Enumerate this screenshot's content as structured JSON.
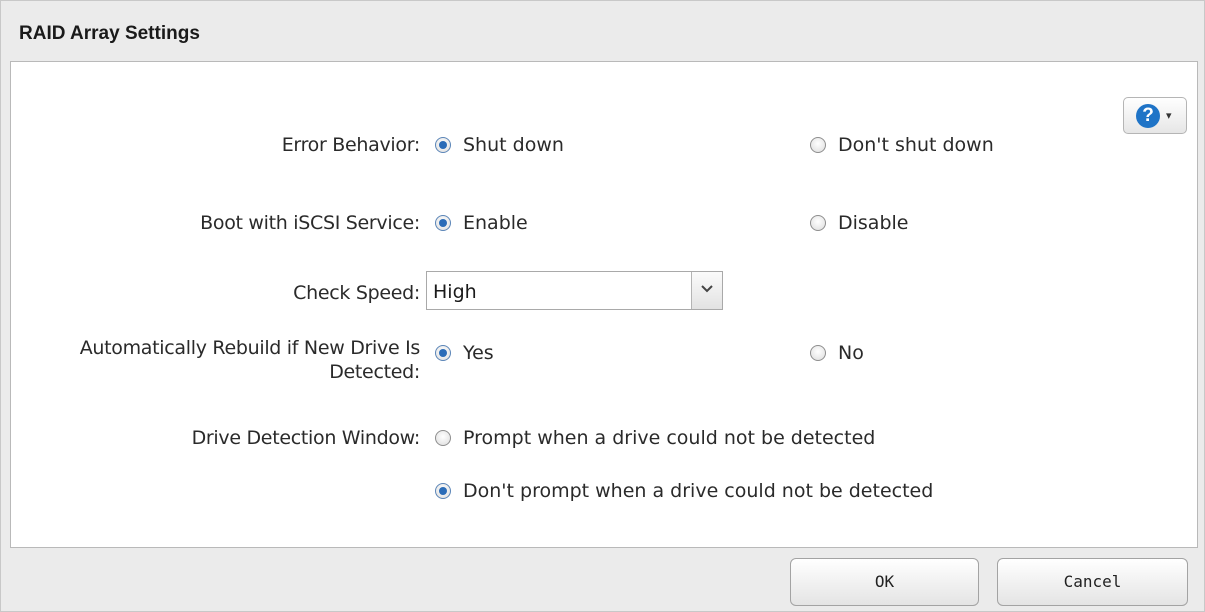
{
  "dialog": {
    "title": "RAID Array Settings"
  },
  "help": {
    "icon": "help-icon",
    "glyph": "?",
    "caret": "▾",
    "color": "#1f74c7"
  },
  "error_behavior": {
    "label": "Error Behavior:",
    "options": [
      {
        "label": "Shut down",
        "selected": true
      },
      {
        "label": "Don't shut down",
        "selected": false
      }
    ]
  },
  "iscsi": {
    "label": "Boot with iSCSI Service:",
    "options": [
      {
        "label": "Enable",
        "selected": true
      },
      {
        "label": "Disable",
        "selected": false
      }
    ]
  },
  "check_speed": {
    "label": "Check Speed:",
    "value": "High"
  },
  "auto_rebuild": {
    "label_line1": "Automatically Rebuild if New Drive Is",
    "label_line2": "Detected:",
    "options": [
      {
        "label": "Yes",
        "selected": true
      },
      {
        "label": "No",
        "selected": false
      }
    ]
  },
  "drive_detection": {
    "label": "Drive Detection Window:",
    "options": [
      {
        "label": "Prompt when a drive could not be detected",
        "selected": false
      },
      {
        "label": "Don't prompt when a drive could not be detected",
        "selected": true
      }
    ]
  },
  "buttons": {
    "ok": "OK",
    "cancel": "Cancel"
  },
  "colors": {
    "accent": "#2b6cb8",
    "background": "#ebebeb",
    "panel": "#ffffff"
  }
}
